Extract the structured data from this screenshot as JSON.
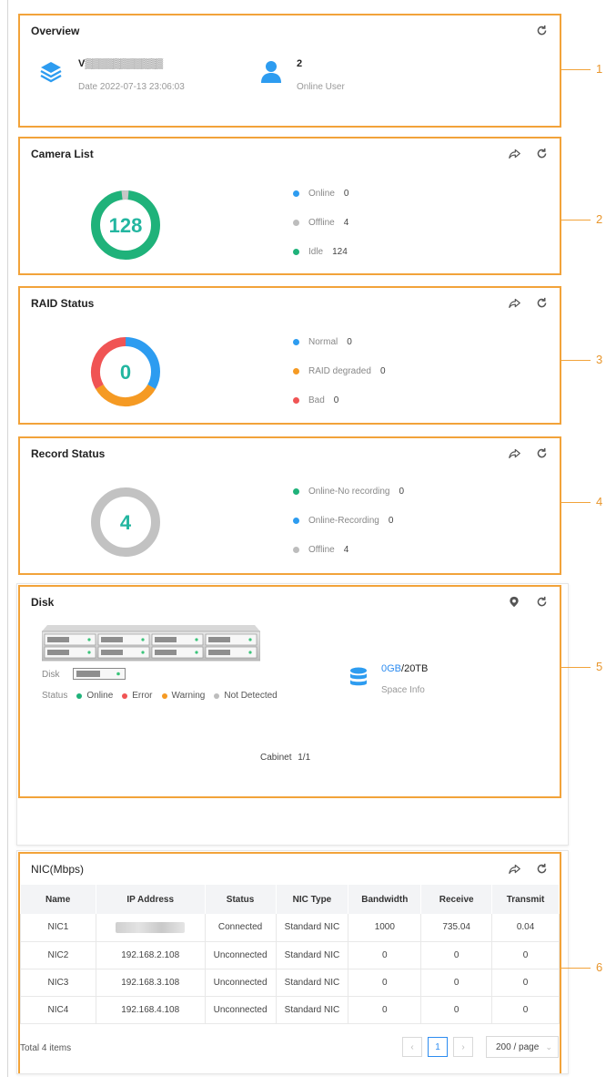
{
  "overview": {
    "title": "Overview",
    "device_name": "V▒▒▒▒▒▒▒▒▒▒▒",
    "date_text": "Date 2022-07-13 23:06:03",
    "online_user_count": "2",
    "online_user_label": "Online User"
  },
  "camera_list": {
    "title": "Camera List",
    "total": "128",
    "legend": [
      {
        "label": "Online",
        "count": "0",
        "color": "#2d9cf0"
      },
      {
        "label": "Offline",
        "count": "4",
        "color": "#bdbdbd"
      },
      {
        "label": "Idle",
        "count": "124",
        "color": "#1fb27a"
      }
    ]
  },
  "raid_status": {
    "title": "RAID Status",
    "total": "0",
    "legend": [
      {
        "label": "Normal",
        "count": "0",
        "color": "#2d9cf0"
      },
      {
        "label": "RAID degraded",
        "count": "0",
        "color": "#f59a23"
      },
      {
        "label": "Bad",
        "count": "0",
        "color": "#f05454"
      }
    ]
  },
  "record_status": {
    "title": "Record Status",
    "total": "4",
    "legend": [
      {
        "label": "Online-No recording",
        "count": "0",
        "color": "#1fb27a"
      },
      {
        "label": "Online-Recording",
        "count": "0",
        "color": "#2d9cf0"
      },
      {
        "label": "Offline",
        "count": "4",
        "color": "#bdbdbd"
      }
    ]
  },
  "disk": {
    "title": "Disk",
    "disk_label": "Disk",
    "status_label": "Status",
    "status_items": [
      {
        "label": "Online",
        "color": "#1fb27a"
      },
      {
        "label": "Error",
        "color": "#f05454"
      },
      {
        "label": "Warning",
        "color": "#f59a23"
      },
      {
        "label": "Not Detected",
        "color": "#bdbdbd"
      }
    ],
    "space_used": "0GB",
    "space_total": "/20TB",
    "space_label": "Space Info",
    "cabinet_label": "Cabinet",
    "cabinet_value": "1/1"
  },
  "nic": {
    "title": "NIC(Mbps)",
    "columns": [
      "Name",
      "IP Address",
      "Status",
      "NIC Type",
      "Bandwidth",
      "Receive",
      "Transmit"
    ],
    "rows": [
      [
        "NIC1",
        "",
        "Connected",
        "Standard NIC",
        "1000",
        "735.04",
        "0.04"
      ],
      [
        "NIC2",
        "192.168.2.108",
        "Unconnected",
        "Standard NIC",
        "0",
        "0",
        "0"
      ],
      [
        "NIC3",
        "192.168.3.108",
        "Unconnected",
        "Standard NIC",
        "0",
        "0",
        "0"
      ],
      [
        "NIC4",
        "192.168.4.108",
        "Unconnected",
        "Standard NIC",
        "0",
        "0",
        "0"
      ]
    ],
    "total_text": "Total 4 items",
    "current_page": "1",
    "page_size": "200 / page"
  },
  "callouts": [
    "1",
    "2",
    "3",
    "4",
    "5",
    "6"
  ]
}
